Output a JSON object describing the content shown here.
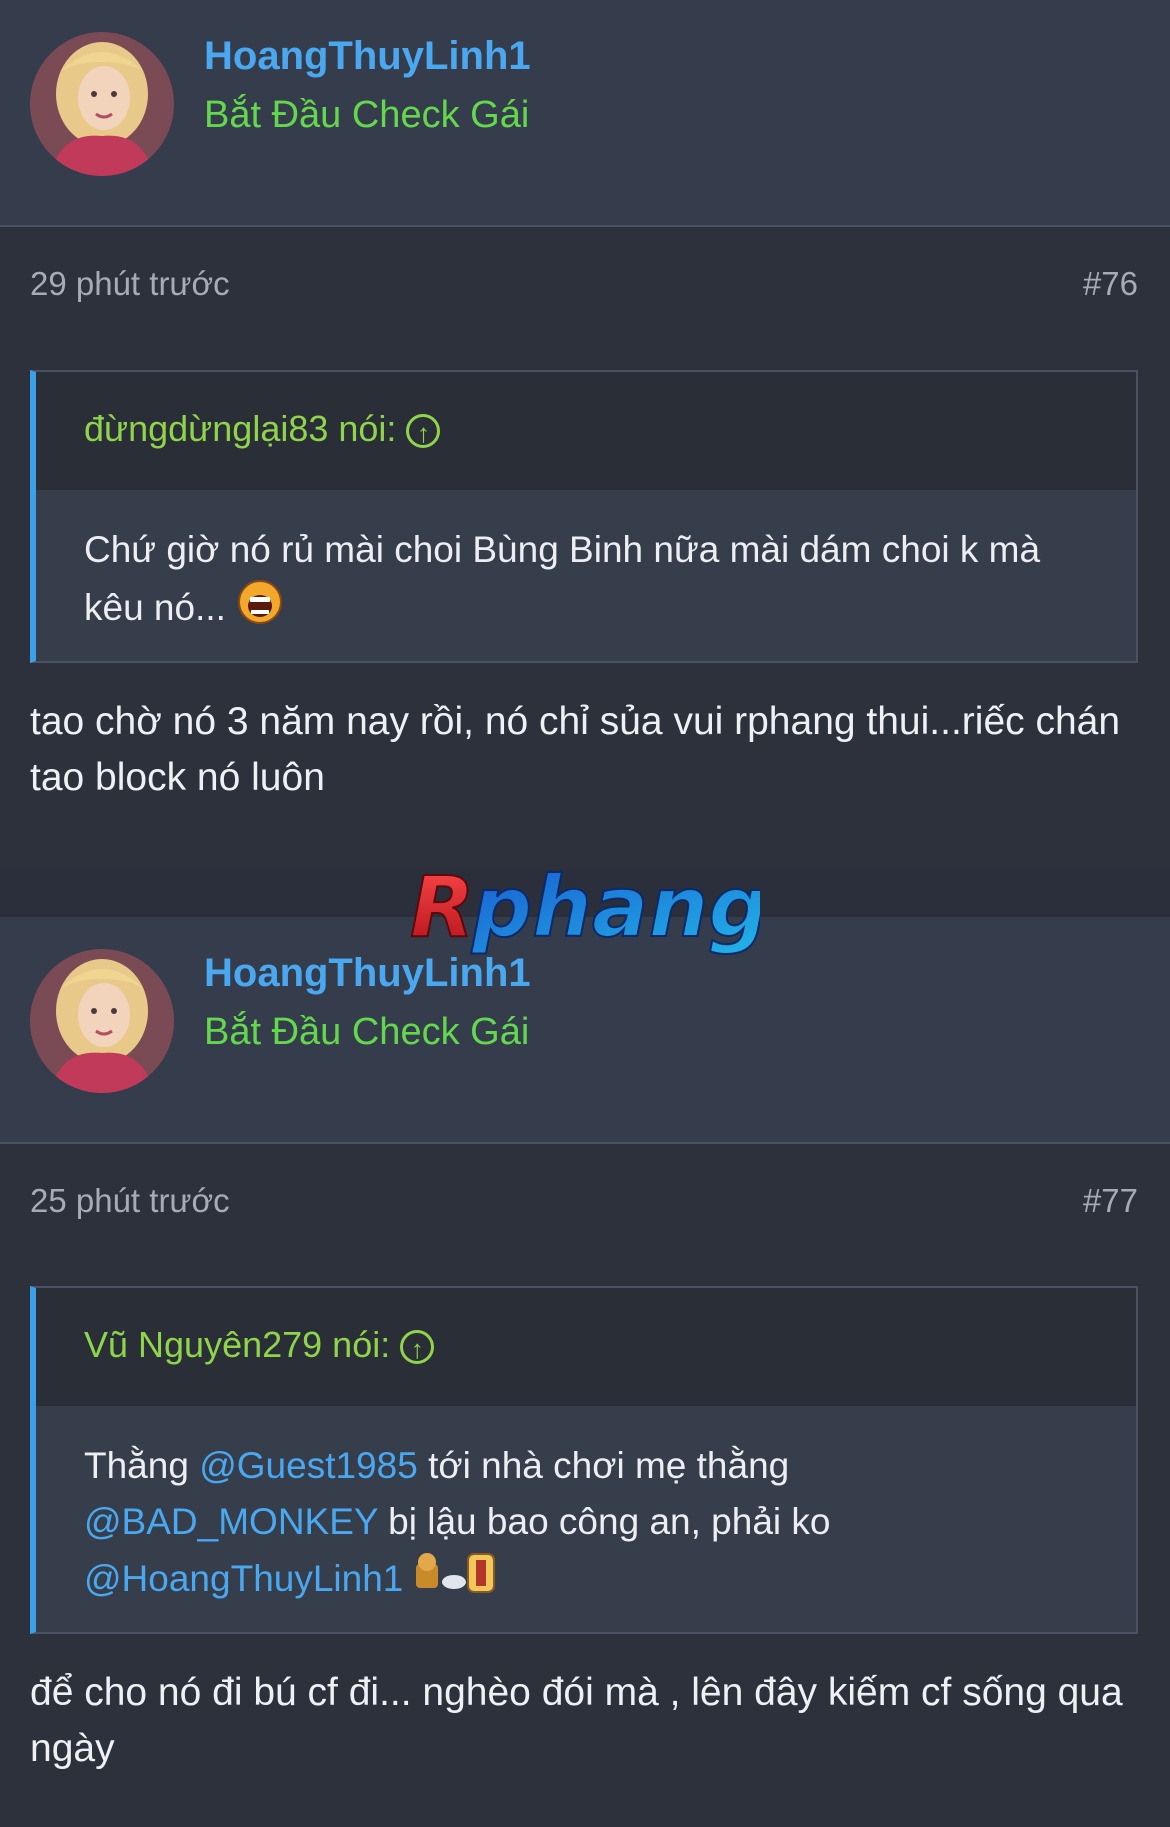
{
  "posts": [
    {
      "username": "HoangThuyLinh1",
      "user_title": "Bắt Đầu Check Gái",
      "time": "29 phút trước",
      "number": "#76",
      "quote": {
        "author": "đừngdừnglại83 nói:",
        "text": "Chứ giờ nó rủ mài choi Bùng Binh nữa mài dám choi k mà kêu nó..."
      },
      "message": "tao chờ nó 3 năm nay rồi, nó chỉ sủa vui rphang thui...riếc chán tao block nó luôn"
    },
    {
      "username": "HoangThuyLinh1",
      "user_title": "Bắt Đầu Check Gái",
      "time": "25 phút trước",
      "number": "#77",
      "quote": {
        "author": "Vũ Nguyên279 nói:",
        "text_1": "Thằng ",
        "mention_1": "@Guest1985",
        "text_2": " tới nhà chơi mẹ thằng",
        "mention_2": "@BAD_MONKEY",
        "text_3": " bị lậu bao công an, phải ko",
        "mention_3": "@HoangThuyLinh1"
      },
      "message": "để cho nó đi bú cf đi... nghèo đói mà , lên đây kiếm cf sống qua ngày"
    }
  ],
  "watermark": "Rphang",
  "colors": {
    "username": "#4aa8f0",
    "title": "#63d84c",
    "quote_author": "#8fd44a",
    "quote_bar": "#3aa0e8"
  }
}
